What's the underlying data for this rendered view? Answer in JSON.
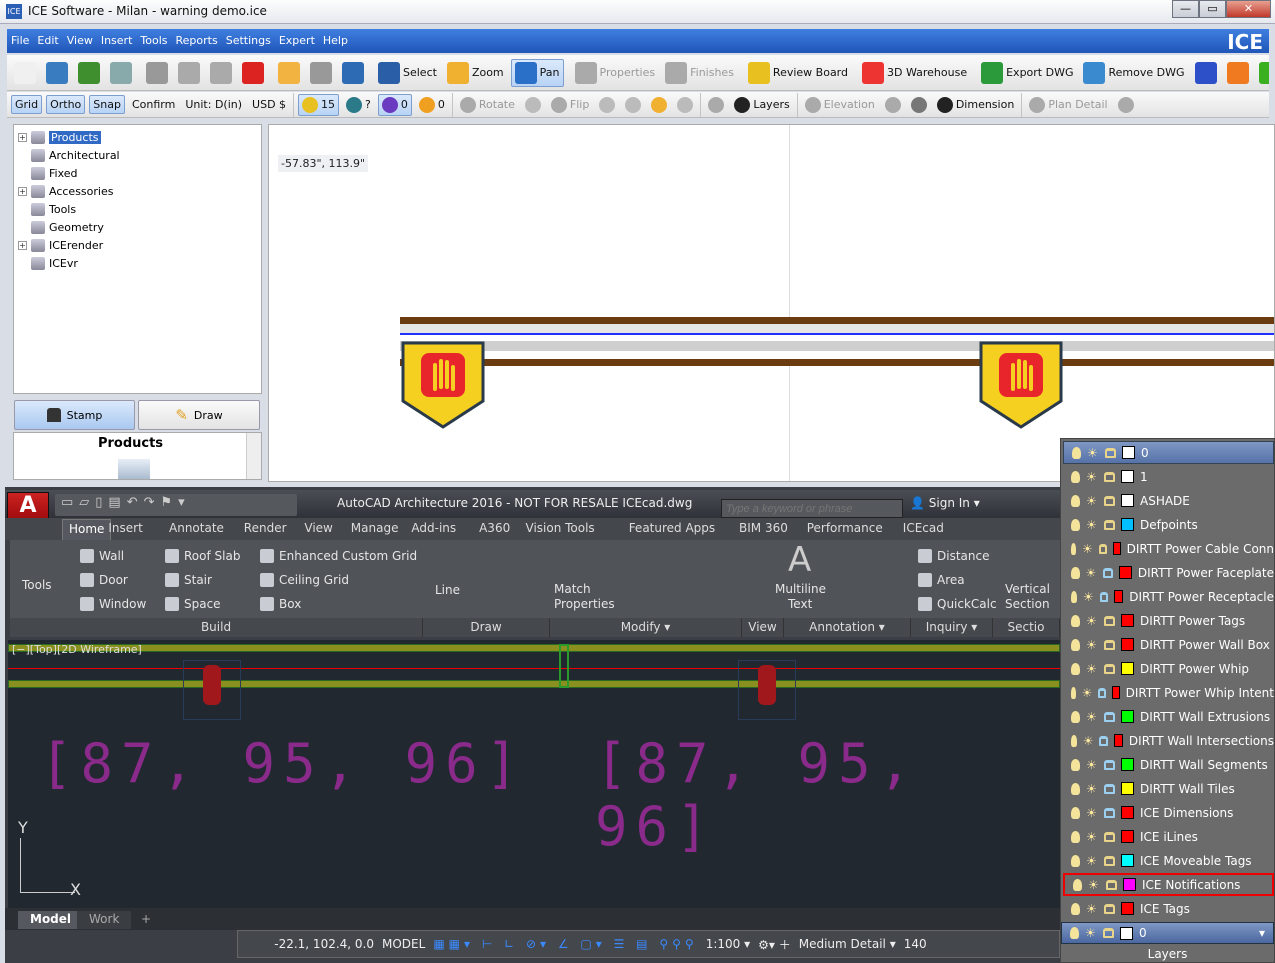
{
  "window": {
    "title": "ICE Software - Milan - warning demo.ice",
    "app_icon": "ICE",
    "min": "—",
    "max": "▭",
    "close": "✕"
  },
  "menu": {
    "items": [
      "File",
      "Edit",
      "View",
      "Insert",
      "Tools",
      "Reports",
      "Settings",
      "Expert",
      "Help"
    ],
    "brand": "ICE"
  },
  "toolbar1": [
    {
      "icon": "new-icon",
      "label": "",
      "color": "#f0f0f0"
    },
    {
      "icon": "open-icon",
      "label": "",
      "color": "#3a7cc0"
    },
    {
      "icon": "save-icon",
      "label": "",
      "color": "#3f8f2f"
    },
    {
      "icon": "print-icon",
      "label": "",
      "color": "#8aa"
    },
    "sep",
    {
      "icon": "cut-icon",
      "label": "",
      "color": "#999"
    },
    {
      "icon": "copy-icon",
      "label": "",
      "color": "#aaa"
    },
    {
      "icon": "paste-icon",
      "label": "",
      "color": "#aaa"
    },
    {
      "icon": "delete-icon",
      "label": "",
      "color": "#d22"
    },
    "sep",
    {
      "icon": "undo-icon",
      "label": "",
      "color": "#f2b340"
    },
    {
      "icon": "redo-icon",
      "label": "",
      "color": "#999"
    },
    {
      "icon": "refresh-icon",
      "label": "",
      "color": "#2d6cb5"
    },
    "sep",
    {
      "icon": "select-icon",
      "label": "Select",
      "color": "#2a5fa8"
    },
    {
      "icon": "zoom-icon",
      "label": "Zoom",
      "color": "#f0b030"
    },
    {
      "icon": "pan-icon",
      "label": "Pan",
      "color": "#2a70c8",
      "on": true
    },
    "sep",
    {
      "icon": "properties-icon",
      "label": "Properties",
      "color": "#aaa",
      "dis": true
    },
    {
      "icon": "finishes-icon",
      "label": "Finishes",
      "color": "#aaa",
      "dis": true
    },
    "sep",
    {
      "icon": "review-board-icon",
      "label": "Review Board",
      "color": "#e8c020"
    },
    "sep",
    {
      "icon": "3d-warehouse-icon",
      "label": "3D Warehouse",
      "color": "#e33"
    },
    "sep",
    {
      "icon": "export-dwg-icon",
      "label": "Export DWG",
      "color": "#2a9a3a"
    },
    {
      "icon": "remove-dwg-icon",
      "label": "Remove DWG",
      "color": "#3a8ad0"
    },
    {
      "icon": "vr-icon",
      "label": "",
      "color": "#2d4fc8"
    },
    {
      "icon": "cube-icon",
      "label": "",
      "color": "#f07a20"
    },
    {
      "icon": "dollar-icon",
      "label": "",
      "color": "#3ab020"
    },
    {
      "icon": "overflow-icon",
      "label": "»",
      "color": ""
    }
  ],
  "toolbar2": [
    {
      "icon": "",
      "label": "Grid",
      "on": true
    },
    {
      "icon": "",
      "label": "Ortho",
      "on": true
    },
    {
      "icon": "",
      "label": "Snap",
      "on": true
    },
    {
      "icon": "",
      "label": "Confirm"
    },
    {
      "icon": "",
      "label": "Unit: D(in)"
    },
    {
      "icon": "",
      "label": "USD $"
    },
    "sep",
    {
      "icon": "warning-shield-icon",
      "label": "15",
      "color": "#e8c020",
      "on": true
    },
    {
      "icon": "fyi-icon",
      "label": "?",
      "color": "#2a7a8a"
    },
    {
      "icon": "shapes-icon",
      "label": "0",
      "color": "#6a3ac0",
      "on": true
    },
    {
      "icon": "p-badge-icon",
      "label": "0",
      "color": "#f0a020"
    },
    "sep",
    {
      "icon": "rotate-icon",
      "label": "Rotate",
      "color": "#aaa",
      "dis": true
    },
    {
      "icon": "stretch-icon",
      "label": "",
      "color": "#bbb"
    },
    {
      "icon": "flip-icon",
      "label": "Flip",
      "color": "#aaa",
      "dis": true
    },
    {
      "icon": "align-h-icon",
      "label": "",
      "color": "#bbb"
    },
    {
      "icon": "align-v-icon",
      "label": "",
      "color": "#bbb"
    },
    {
      "icon": "power-icon",
      "label": "",
      "color": "#f0b030"
    },
    {
      "icon": "split-icon",
      "label": "",
      "color": "#bbb"
    },
    "sep",
    {
      "icon": "grid-layers-icon",
      "label": "",
      "color": "#aaa"
    },
    {
      "icon": "layers-icon",
      "label": "Layers",
      "color": "#222"
    },
    "sep",
    {
      "icon": "elevation-icon",
      "label": "Elevation",
      "color": "#aaa",
      "dis": true
    },
    {
      "icon": "diamond-icon",
      "label": "",
      "color": "#aaa"
    },
    {
      "icon": "hourglass-icon",
      "label": "",
      "color": "#777"
    },
    {
      "icon": "dimension-icon",
      "label": "Dimension",
      "color": "#222"
    },
    "sep",
    {
      "icon": "plan-detail-icon",
      "label": "Plan Detail",
      "color": "#aaa",
      "dis": true
    },
    {
      "icon": "text-frame-icon",
      "label": "",
      "color": "#aaa"
    }
  ],
  "tree": {
    "items": [
      {
        "label": "Products",
        "exp": true,
        "sel": true
      },
      {
        "label": "Architectural"
      },
      {
        "label": "Fixed"
      },
      {
        "label": "Accessories",
        "exp": true
      },
      {
        "label": "Tools"
      },
      {
        "label": "Geometry"
      },
      {
        "label": "ICErender",
        "exp": true
      },
      {
        "label": "ICEvr"
      }
    ]
  },
  "left": {
    "stamp": "Stamp",
    "draw": "Draw",
    "products_title": "Products"
  },
  "canvas": {
    "coord": "-57.83\", 113.9\""
  },
  "acad": {
    "title": "AutoCAD Architecture 2016 - NOT FOR RESALE     ICEcad.dwg",
    "search_placeholder": "Type a keyword or phrase",
    "sign_in": "Sign In",
    "app_letter": "A",
    "tabs": [
      "Home",
      "Insert",
      "Annotate",
      "Render",
      "View",
      "Manage",
      "Add-ins",
      "A360",
      "Vision Tools",
      "Featured Apps",
      "BIM 360",
      "Performance",
      "ICEcad"
    ],
    "build": {
      "tools": "Tools",
      "items": [
        "Wall",
        "Door",
        "Window",
        "Roof Slab",
        "Stair",
        "Space",
        "Enhanced Custom Grid",
        "Ceiling Grid",
        "Box"
      ]
    },
    "draw": {
      "line": "Line"
    },
    "modify": {
      "match1": "Match",
      "match2": "Properties"
    },
    "annotation": {
      "mt1": "Multiline",
      "mt2": "Text"
    },
    "inquiry": [
      "Distance",
      "Area",
      "QuickCalc"
    ],
    "section": {
      "v1": "Vertical",
      "v2": "Section"
    },
    "panels": [
      "Build",
      "Draw",
      "Modify ▾",
      "View",
      "Annotation ▾",
      "Inquiry ▾",
      "Sectio"
    ],
    "viewport_label": "[−][Top][2D Wireframe]",
    "dim_text": "[87, 95, 96]",
    "ucs": {
      "y": "Y",
      "x": "X"
    },
    "model_tabs": [
      "Model",
      "Work",
      "+"
    ],
    "status": {
      "coords": "-22.1, 102.4, 0.0",
      "space": "MODEL",
      "scale": "1:100 ▾",
      "detail": "Medium Detail ▾",
      "num": "140"
    }
  },
  "layers": {
    "title": "Layers",
    "current": "0",
    "items": [
      {
        "name": "0",
        "color": "#ffffff",
        "locked": false,
        "current": true
      },
      {
        "name": "1",
        "color": "#ffffff",
        "locked": false
      },
      {
        "name": "ASHADE",
        "color": "#ffffff",
        "locked": false
      },
      {
        "name": "Defpoints",
        "color": "#00bfff",
        "locked": false
      },
      {
        "name": "DIRTT Power Cable Conn",
        "color": "#ff0000",
        "locked": false
      },
      {
        "name": "DIRTT Power Faceplate",
        "color": "#ff0000",
        "locked": true
      },
      {
        "name": "DIRTT Power Receptacle",
        "color": "#ff0000",
        "locked": true
      },
      {
        "name": "DIRTT Power Tags",
        "color": "#ff0000",
        "locked": false
      },
      {
        "name": "DIRTT Power Wall Box",
        "color": "#ff0000",
        "locked": false
      },
      {
        "name": "DIRTT Power Whip",
        "color": "#ffff00",
        "locked": false
      },
      {
        "name": "DIRTT Power Whip Intent",
        "color": "#ff0000",
        "locked": true
      },
      {
        "name": "DIRTT Wall Extrusions",
        "color": "#00ff00",
        "locked": true
      },
      {
        "name": "DIRTT Wall Intersections",
        "color": "#ff0000",
        "locked": true
      },
      {
        "name": "DIRTT Wall Segments",
        "color": "#00ff00",
        "locked": true
      },
      {
        "name": "DIRTT Wall Tiles",
        "color": "#ffff00",
        "locked": true
      },
      {
        "name": "ICE Dimensions",
        "color": "#ff0000",
        "locked": true
      },
      {
        "name": "ICE iLines",
        "color": "#ff0000",
        "locked": false
      },
      {
        "name": "ICE Moveable Tags",
        "color": "#00ffff",
        "locked": false
      },
      {
        "name": "ICE Notifications",
        "color": "#ff00ff",
        "locked": false,
        "highlight": true
      },
      {
        "name": "ICE Tags",
        "color": "#ff0000",
        "locked": false
      }
    ]
  }
}
